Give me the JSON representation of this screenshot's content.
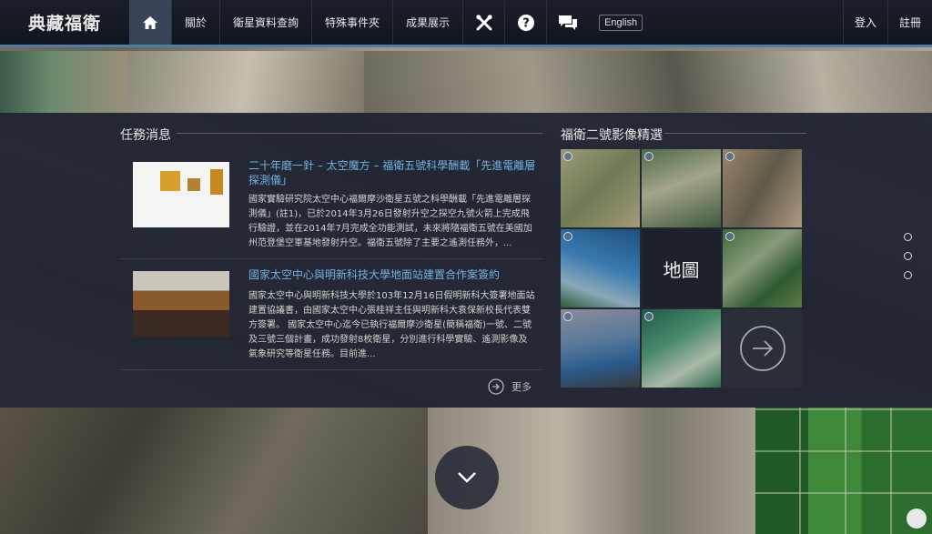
{
  "header": {
    "logo": "典藏福衛",
    "nav": [
      {
        "label": "關於"
      },
      {
        "label": "衛星資料查詢"
      },
      {
        "label": "特殊事件夾"
      },
      {
        "label": "成果展示"
      }
    ],
    "icons": [
      "home-icon",
      "tools-icon",
      "help-icon",
      "chat-icon"
    ],
    "language_button": "English",
    "login": "登入",
    "register": "註冊"
  },
  "news": {
    "title": "任務消息",
    "items": [
      {
        "title": "二十年磨一針 – 太空魔方 – 福衛五號科學酬載「先進電離層探測儀」",
        "body": "國家實驗研究院太空中心福爾摩沙衛星五號之科學酬載「先進電離層探測儀」(註1)，已於2014年3月26日發射升空之探空九號火箭上完成飛行驗證，並在2014年7月完成全功能測試，未來將隨福衛五號在美國加州范登堡空軍基地發射升空。福衛五號除了主要之遙測任務外，..."
      },
      {
        "title": "國家太空中心與明新科技大學地面站建置合作案簽約",
        "body": "國家太空中心與明新科技大學於103年12月16日假明新科大簽署地面站建置協議書，由國家太空中心張桂祥主任與明新科大袁保新校長代表雙方簽署。 國家太空中心迄今已執行福爾摩沙衛星(簡稱福衛)一號、二號及三號三個計畫，成功發射8枚衛星，分別進行科學實驗、遙測影像及氣象研究等衛星任務。目前進..."
      }
    ],
    "more": "更多"
  },
  "gallery": {
    "title": "福衛二號影像精選",
    "map_label": "地圖",
    "tiles": [
      {
        "name": "satellite-image-1",
        "color": "#8a8f6a"
      },
      {
        "name": "satellite-image-2",
        "color": "#5c6a4c"
      },
      {
        "name": "satellite-image-3",
        "color": "#8a7a66"
      },
      {
        "name": "satellite-image-4",
        "color": "#2f5f8a"
      },
      {
        "name": "satellite-image-5",
        "color": "#3e6a3a"
      },
      {
        "name": "satellite-image-6",
        "color": "#7c8a9a"
      },
      {
        "name": "satellite-image-7",
        "color": "#2f6a55"
      }
    ]
  },
  "colors": {
    "accent": "#4d7fa6",
    "link": "#6fb2e0",
    "panel": "#1e2230"
  }
}
